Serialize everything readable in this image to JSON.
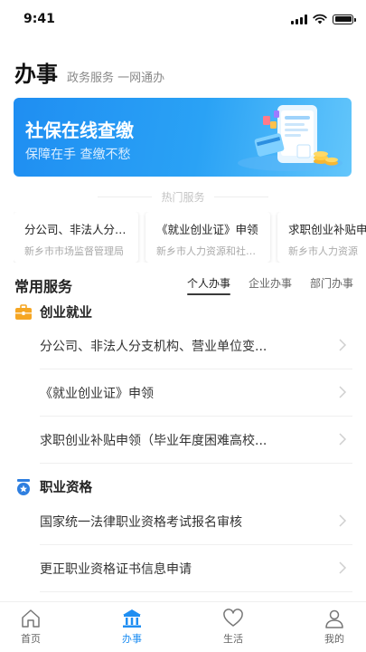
{
  "status_bar": {
    "time": "9:41"
  },
  "header": {
    "title": "办事",
    "subtitle": "政务服务 一网通办"
  },
  "banner": {
    "title": "社保在线查缴",
    "subtitle": "保障在手 查缴不愁"
  },
  "hot_services": {
    "label": "热门服务",
    "cards": [
      {
        "title": "分公司、非法人分支机构、营业单位变更",
        "dept": "新乡市市场监督管理局"
      },
      {
        "title": "《就业创业证》申领",
        "dept": "新乡市人力资源和社会保障局"
      },
      {
        "title": "求职创业补贴申领",
        "dept": "新乡市人力资源"
      }
    ]
  },
  "common_services": {
    "title": "常用服务",
    "tabs": [
      {
        "label": "个人办事",
        "active": true
      },
      {
        "label": "企业办事",
        "active": false
      },
      {
        "label": "部门办事",
        "active": false
      }
    ],
    "categories": [
      {
        "label": "创业就业",
        "icon": "briefcase-icon",
        "items": [
          "分公司、非法人分支机构、营业单位变...",
          "《就业创业证》申领",
          "求职创业补贴申领（毕业年度困难高校..."
        ]
      },
      {
        "label": "职业资格",
        "icon": "badge-star-icon",
        "items": [
          "国家统一法律职业资格考试报名审核",
          "更正职业资格证书信息申请"
        ]
      }
    ]
  },
  "bottom_nav": [
    {
      "label": "首页",
      "icon": "home-icon",
      "active": false
    },
    {
      "label": "办事",
      "icon": "government-building-icon",
      "active": true
    },
    {
      "label": "生活",
      "icon": "heart-icon",
      "active": false
    },
    {
      "label": "我的",
      "icon": "person-icon",
      "active": false
    }
  ],
  "colors": {
    "accent": "#1f8ef2",
    "category_icon": "#f5a623",
    "badge_icon": "#2f7fe0"
  }
}
